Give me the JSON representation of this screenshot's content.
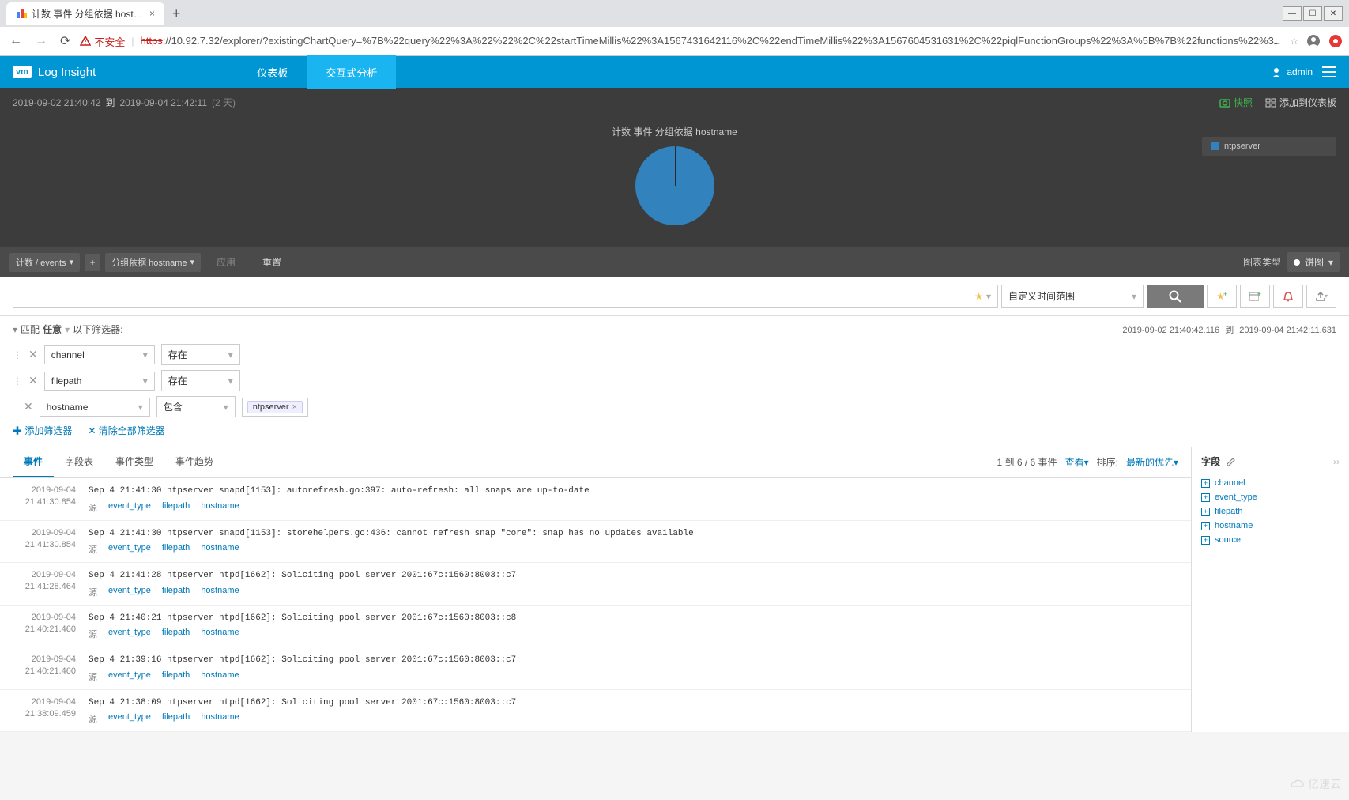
{
  "browser": {
    "tab_title": "计数 事件 分组依据 hostname",
    "security_label": "不安全",
    "url_protocol": "https",
    "url_rest": "://10.92.7.32/explorer/?existingChartQuery=%7B%22query%22%3A%22%22%2C%22startTimeMillis%22%3A1567431642116%2C%22endTimeMillis%22%3A1567604531631%2C%22piqlFunctionGroups%22%3A%5B%7B%22functions%22%3A%5B%7B%22label%22%3A…"
  },
  "header": {
    "product": "Log Insight",
    "logo_text": "vm",
    "nav": {
      "dashboard": "仪表板",
      "interactive": "交互式分析"
    },
    "user": "admin"
  },
  "timebar": {
    "start": "2019-09-02  21:40:42",
    "to": "到",
    "end": "2019-09-04  21:42:11",
    "duration": "(2 天)",
    "snapshot": "快照",
    "add_dashboard": "添加到仪表板"
  },
  "chart": {
    "title": "计数 事件 分组依据 hostname",
    "legend_item": "ntpserver"
  },
  "chart_data": {
    "type": "pie",
    "title": "计数 事件 分组依据 hostname",
    "categories": [
      "ntpserver"
    ],
    "values": [
      6
    ],
    "series": [
      {
        "name": "ntpserver",
        "values": [
          6
        ]
      }
    ]
  },
  "query": {
    "count_pill": "计数 / events",
    "group_pill": "分组依据 hostname",
    "apply": "应用",
    "reset": "重置",
    "chart_type_label": "图表类型",
    "chart_type_value": "饼图"
  },
  "search": {
    "time_range": "自定义时间范围",
    "time_detail_start": "2019-09-02  21:40:42.116",
    "time_detail_to": "到",
    "time_detail_end": "2019-09-04  21:42:11.631"
  },
  "filters": {
    "match_prefix": "匹配",
    "match_mode": "任意",
    "match_suffix": "以下筛选器:",
    "rows": [
      {
        "field": "channel",
        "op": "存在",
        "value": ""
      },
      {
        "field": "filepath",
        "op": "存在",
        "value": ""
      },
      {
        "field": "hostname",
        "op": "包含",
        "value": "ntpserver"
      }
    ],
    "add": "添加筛选器",
    "clear": "清除全部筛选器"
  },
  "tabs": {
    "events": "事件",
    "fieldtable": "字段表",
    "eventtypes": "事件类型",
    "eventtrends": "事件趋势"
  },
  "results": {
    "count_text": "1 到 6 / 6 事件",
    "view": "查看",
    "sort_label": "排序:",
    "sort_value": "最新的优先"
  },
  "events": [
    {
      "date": "2019-09-04",
      "time": "21:41:30.854",
      "msg": "Sep  4 21:41:30 ntpserver snapd[1153]: autorefresh.go:397: auto-refresh: all snaps are up-to-date"
    },
    {
      "date": "2019-09-04",
      "time": "21:41:30.854",
      "msg": "Sep  4 21:41:30 ntpserver snapd[1153]: storehelpers.go:436: cannot refresh snap \"core\": snap has no updates available"
    },
    {
      "date": "2019-09-04",
      "time": "21:41:28.464",
      "msg": "Sep  4 21:41:28 ntpserver ntpd[1662]: Soliciting pool server 2001:67c:1560:8003::c7"
    },
    {
      "date": "2019-09-04",
      "time": "21:40:21.460",
      "msg": "Sep  4 21:40:21 ntpserver ntpd[1662]: Soliciting pool server 2001:67c:1560:8003::c8"
    },
    {
      "date": "2019-09-04",
      "time": "21:40:21.460",
      "msg": "Sep  4 21:39:16 ntpserver ntpd[1662]: Soliciting pool server 2001:67c:1560:8003::c7"
    },
    {
      "date": "2019-09-04",
      "time": "21:38:09.459",
      "msg": "Sep  4 21:38:09 ntpserver ntpd[1662]: Soliciting pool server 2001:67c:1560:8003::c7"
    }
  ],
  "event_field_labels": {
    "source": "源",
    "f1": "event_type",
    "f2": "filepath",
    "f3": "hostname"
  },
  "sidebar": {
    "title": "字段",
    "fields": [
      "channel",
      "event_type",
      "filepath",
      "hostname",
      "source"
    ]
  },
  "watermark": "亿速云"
}
